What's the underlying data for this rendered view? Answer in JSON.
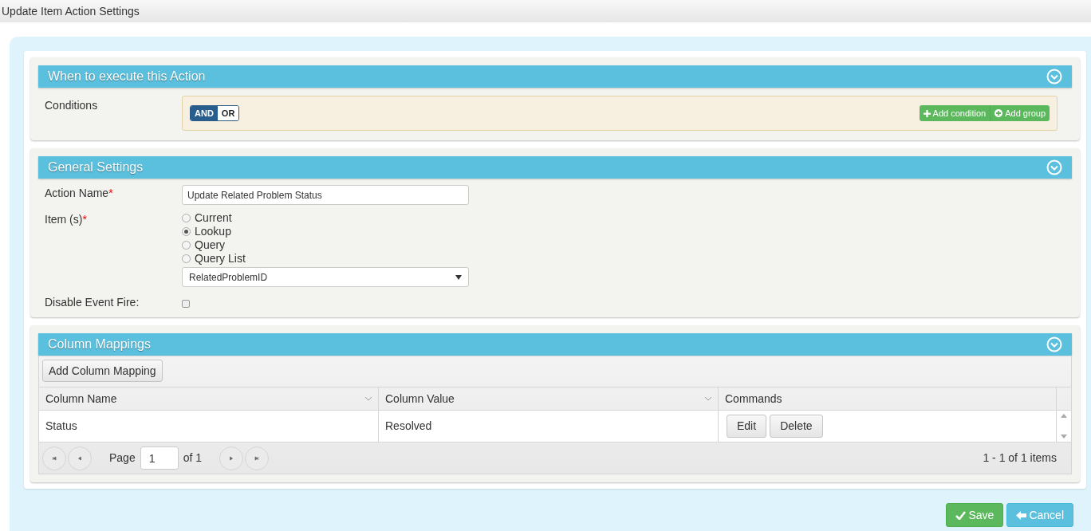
{
  "window": {
    "title": "Update Item Action Settings"
  },
  "conditions_section": {
    "title": "When to execute this Action",
    "label": "Conditions",
    "logic": [
      {
        "label": "AND",
        "selected": true
      },
      {
        "label": "OR",
        "selected": false
      }
    ],
    "buttons": [
      {
        "kind": "plus",
        "label": "Add condition"
      },
      {
        "kind": "circle-plus",
        "label": "Add group"
      }
    ]
  },
  "general_section": {
    "title": "General Settings",
    "action_name": {
      "label": "Action Name",
      "required_mark": "*",
      "value": "Update Related Problem Status"
    },
    "items": {
      "label": "Item (s)",
      "required_mark": "*",
      "options": [
        {
          "label": "Current",
          "selected": false
        },
        {
          "label": "Lookup",
          "selected": true
        },
        {
          "label": "Query",
          "selected": false
        },
        {
          "label": "Query List",
          "selected": false
        }
      ],
      "lookup_field": "RelatedProblemID"
    },
    "disable_event_fire": {
      "label": "Disable Event Fire:",
      "checked": false
    }
  },
  "mappings_section": {
    "title": "Column Mappings",
    "add_button": "Add Column Mapping",
    "table": {
      "columns": [
        {
          "label": "Column Name",
          "sortable": true
        },
        {
          "label": "Column Value",
          "sortable": true
        },
        {
          "label": "Commands",
          "sortable": false
        }
      ],
      "rows": [
        {
          "name": "Status",
          "value": "Resolved",
          "commands": [
            "Edit",
            "Delete"
          ]
        }
      ]
    },
    "pager": {
      "page_label": "Page",
      "page": "1",
      "of": "of 1",
      "summary": "1 - 1 of 1 items"
    }
  },
  "footer": {
    "buttons": [
      {
        "kind": "save",
        "label": "Save"
      },
      {
        "kind": "cancel",
        "label": "Cancel"
      }
    ]
  }
}
